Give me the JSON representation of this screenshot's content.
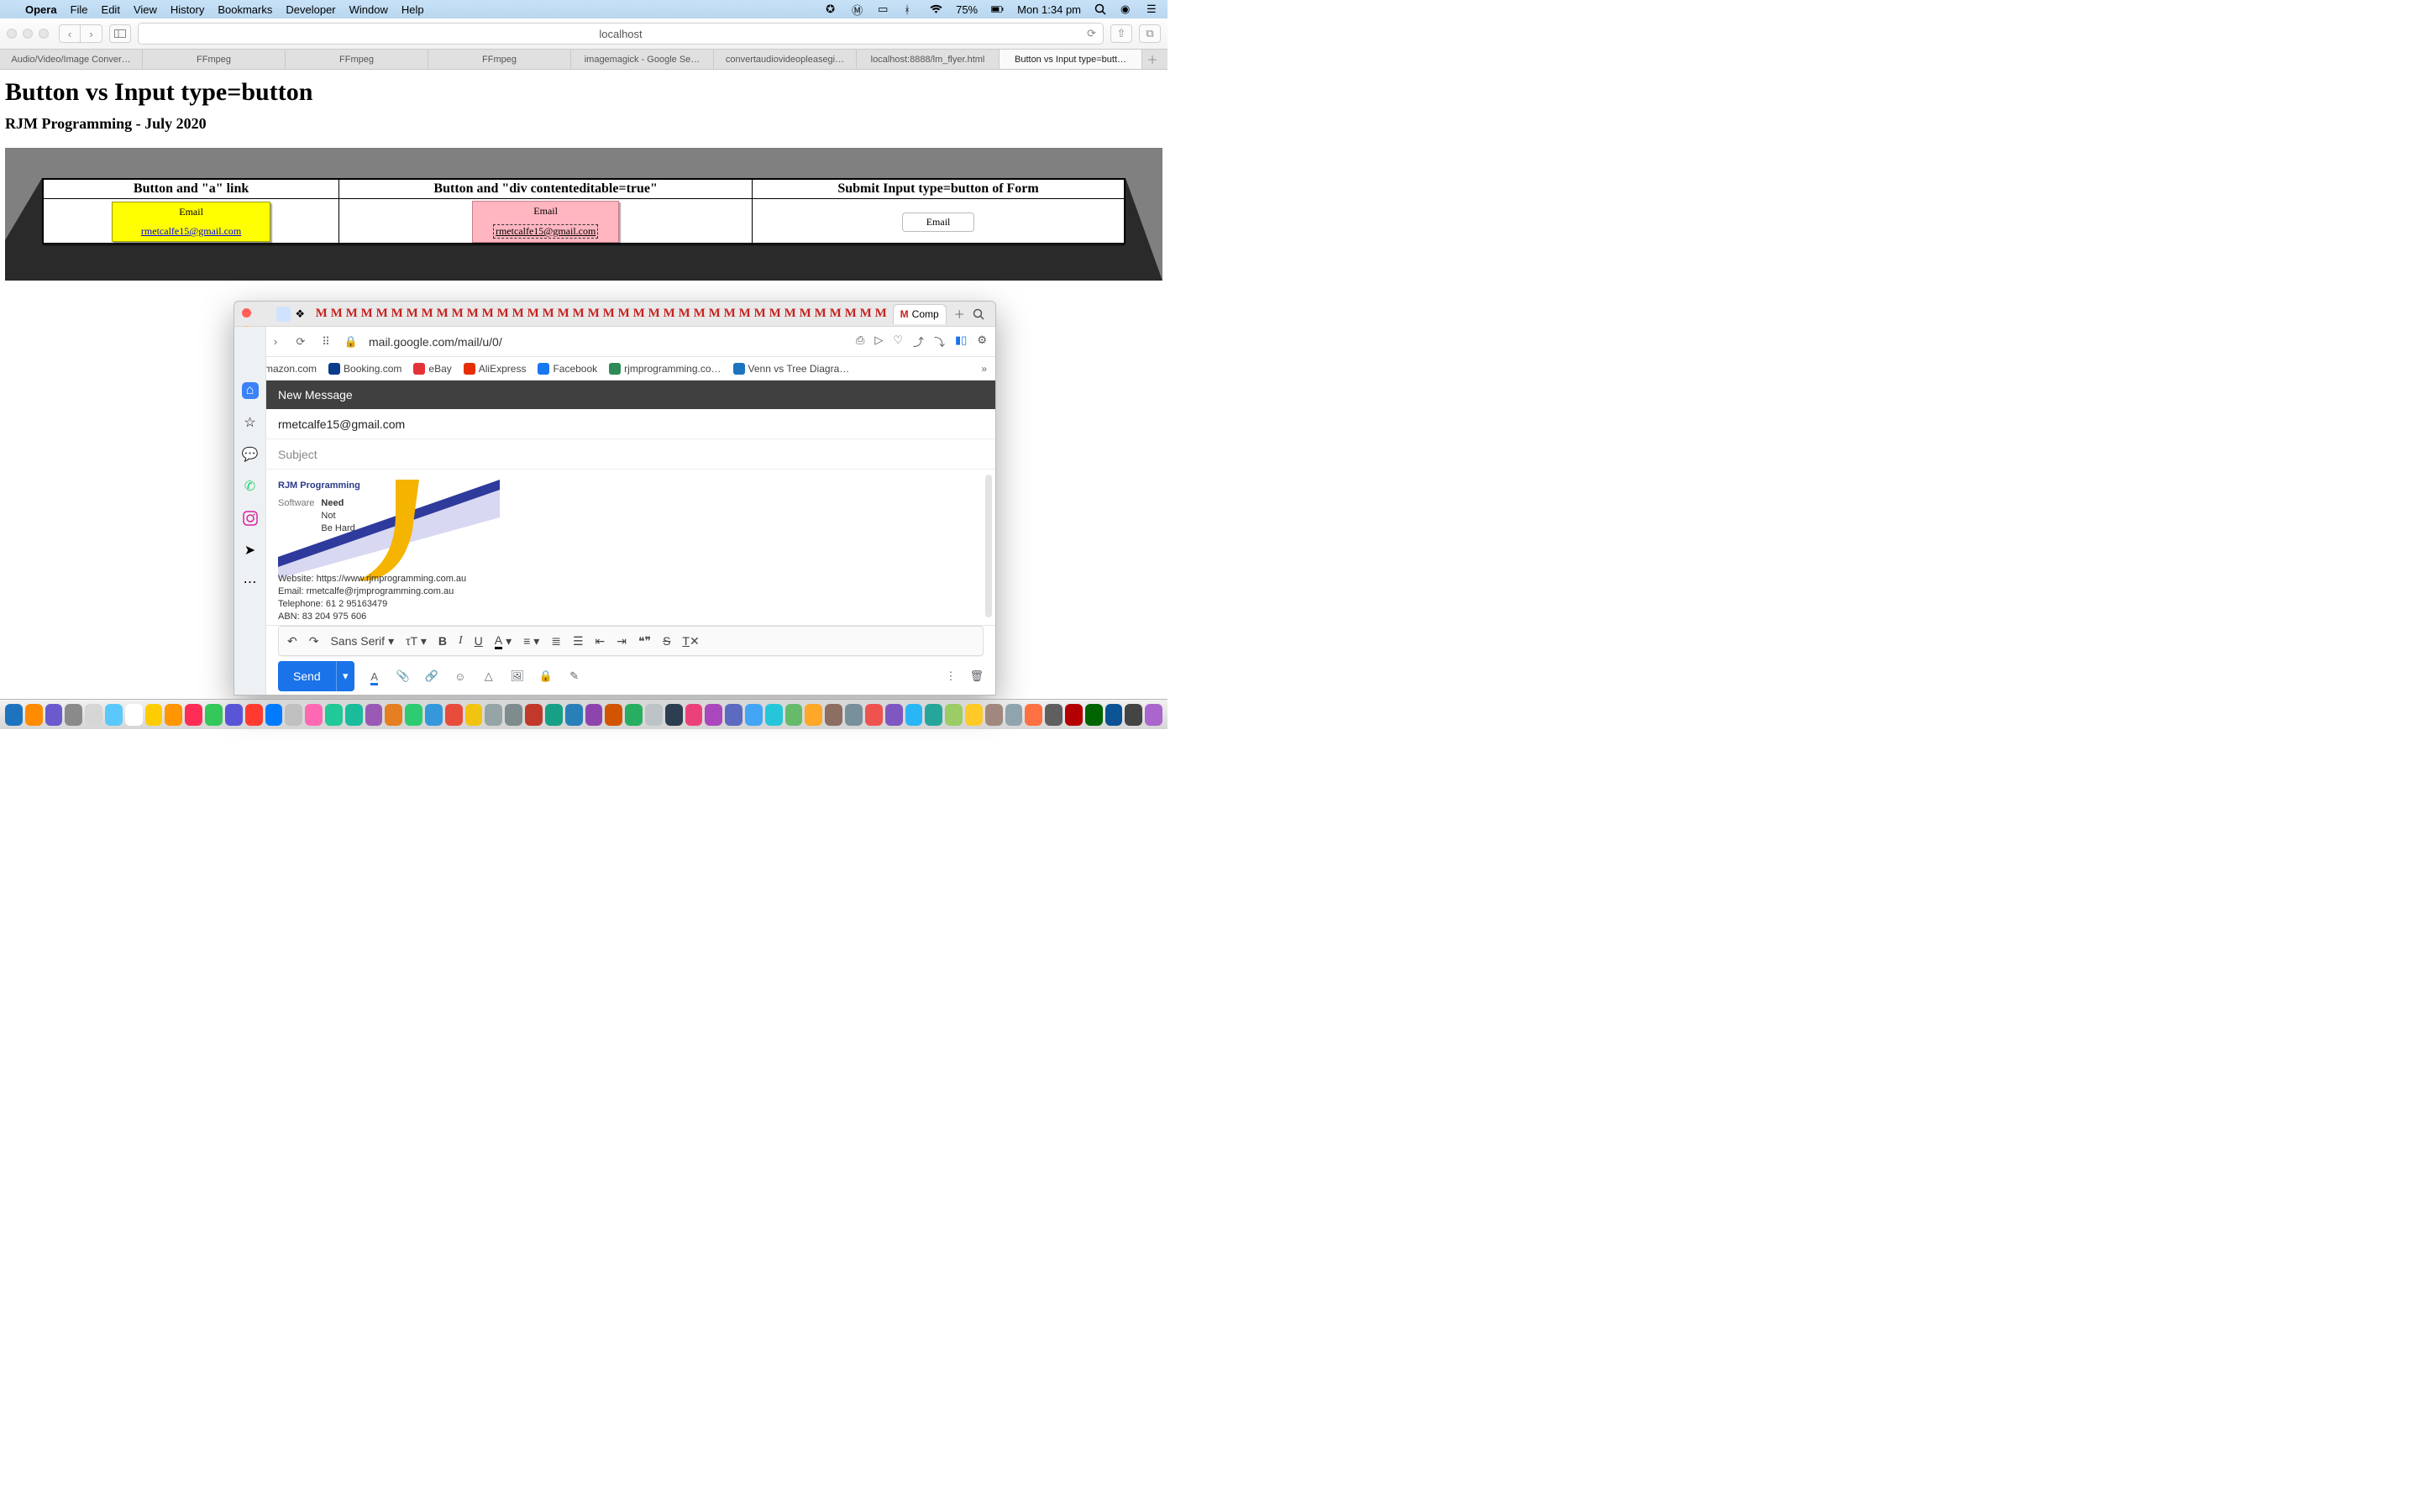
{
  "menubar": {
    "app": "Opera",
    "items": [
      "File",
      "Edit",
      "View",
      "History",
      "Bookmarks",
      "Developer",
      "Window",
      "Help"
    ],
    "battery": "75%",
    "clock": "Mon 1:34 pm"
  },
  "browser": {
    "url": "localhost",
    "tabs": [
      "Audio/Video/Image Conver…",
      "FFmpeg",
      "FFmpeg",
      "FFmpeg",
      "imagemagick - Google Se…",
      "convertaudiovideopleasegi…",
      "localhost:8888/lm_flyer.html",
      "Button vs Input type=butt…"
    ],
    "active_tab_index": 7
  },
  "page": {
    "h1": "Button vs Input type=button",
    "h3": "RJM Programming - July 2020",
    "cols": [
      "Button and \"a\" link",
      "Button and \"div contenteditable=true\"",
      "Submit Input type=button of Form"
    ],
    "email_label": "Email",
    "email_addr": "rmetcalfe15@gmail.com"
  },
  "gmailwin": {
    "url": "mail.google.com/mail/u/0/",
    "compose_tab": "Comp",
    "bookmarks": [
      "Amazon.com",
      "Booking.com",
      "eBay",
      "AliExpress",
      "Facebook",
      "rjmprogramming.co…",
      "Venn vs Tree Diagra…"
    ],
    "bookmark_colors": [
      "#222",
      "#0b3b8c",
      "#e53238",
      "#e62e04",
      "#1877f2",
      "#2e8b57",
      "#1e73be"
    ],
    "new_message": "New Message",
    "to": "rmetcalfe15@gmail.com",
    "subject_placeholder": "Subject",
    "sig": {
      "l1": "RJM Programming",
      "l2a": "Software",
      "l2b": "Need",
      "l2c": "Not",
      "l2d": "Be Hard",
      "l3": "Website: https://www.rjmprogramming.com.au",
      "l4": "Email: rmetcalfe@rjmprogramming.com.au",
      "l5": "Telephone: 61 2 95163479",
      "l6": "ABN: 83 204 975 606"
    },
    "font": "Sans Serif",
    "send": "Send"
  },
  "dock_colors": [
    "#1e73be",
    "#ff8c00",
    "#6a5acd",
    "#8a8a8a",
    "#d6d6d6",
    "#5ac8fa",
    "#ffffff",
    "#ffcc00",
    "#ff9500",
    "#ff2d55",
    "#34c759",
    "#5856d6",
    "#ff3b30",
    "#007aff",
    "#c0c0c0",
    "#ff69b4",
    "#20c997",
    "#1abc9c",
    "#9b59b6",
    "#e67e22",
    "#2ecc71",
    "#3498db",
    "#e74c3c",
    "#f1c40f",
    "#95a5a6",
    "#7f8c8d",
    "#c0392b",
    "#16a085",
    "#2980b9",
    "#8e44ad",
    "#d35400",
    "#27ae60",
    "#bdc3c7",
    "#2c3e50",
    "#ec407a",
    "#ab47bc",
    "#5c6bc0",
    "#42a5f5",
    "#26c6da",
    "#66bb6a",
    "#ffa726",
    "#8d6e63",
    "#78909c",
    "#ef5350",
    "#7e57c2",
    "#29b6f6",
    "#26a69a",
    "#9ccc65",
    "#ffca28",
    "#a1887f",
    "#90a4ae",
    "#ff7043",
    "#5f5f5f",
    "#b40000",
    "#006400",
    "#0b5394",
    "#444444",
    "#aa66cc"
  ]
}
